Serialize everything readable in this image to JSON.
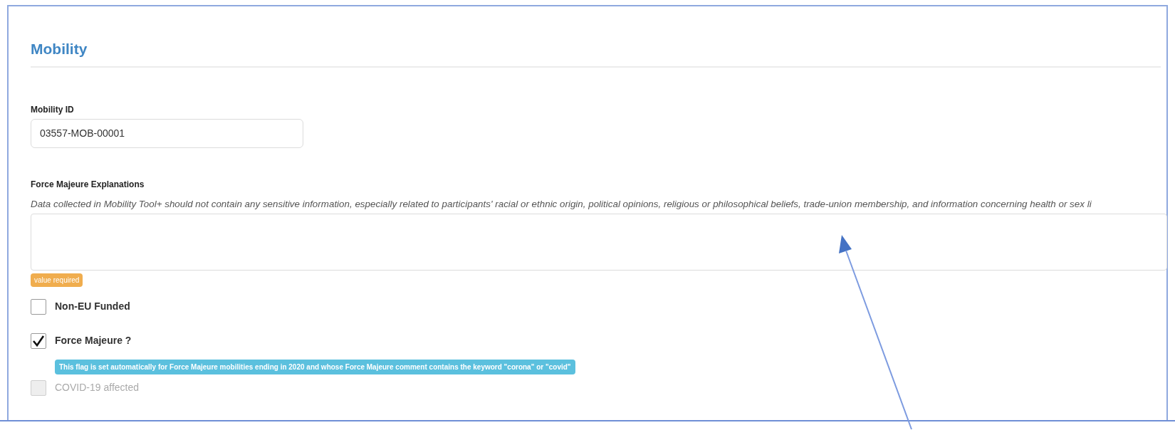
{
  "section": {
    "title": "Mobility"
  },
  "mobility_id": {
    "label": "Mobility ID",
    "value": "03557-MOB-00001"
  },
  "explanations": {
    "label": "Force Majeure Explanations",
    "note": "Data collected in Mobility Tool+ should not contain any sensitive information, especially related to participants' racial or ethnic origin, political opinions, religious or philosophical beliefs, trade-union membership, and information concerning health or sex li",
    "badge": "value required"
  },
  "checkboxes": [
    {
      "label": "Non-EU Funded",
      "checked": false,
      "disabled": false
    },
    {
      "label": "Force Majeure ?",
      "checked": true,
      "disabled": false,
      "info": "This flag is set automatically for Force Majeure mobilities ending in 2020 and whose Force Majeure comment contains the keyword \"corona\" or \"covid\""
    },
    {
      "label": "COVID-19 affected",
      "checked": false,
      "disabled": true
    }
  ]
}
